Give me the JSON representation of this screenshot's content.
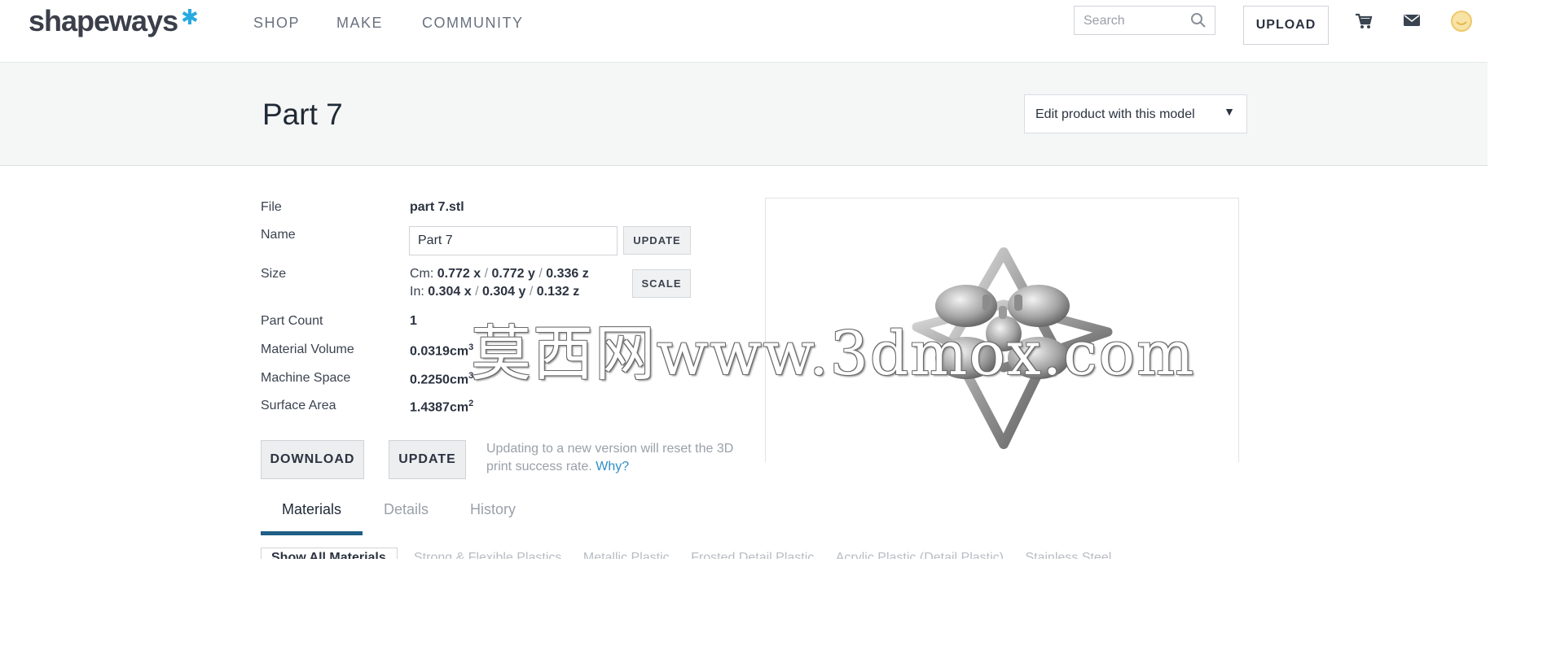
{
  "header": {
    "logo": "shapeways",
    "logo_star_icon": "star-icon",
    "nav": [
      "SHOP",
      "MAKE",
      "COMMUNITY"
    ],
    "search_placeholder": "Search",
    "upload_label": "UPLOAD",
    "icons": [
      "cart-icon",
      "mail-icon",
      "user-avatar-icon"
    ]
  },
  "title_band": {
    "title": "Part 7",
    "edit_dropdown": "Edit product with this model"
  },
  "details": {
    "file": {
      "label": "File",
      "value": "part 7.stl"
    },
    "name": {
      "label": "Name",
      "value": "Part 7",
      "button": "UPDATE"
    },
    "size": {
      "label": "Size",
      "cm_label": "Cm:",
      "cm_x": "0.772 x",
      "cm_y": "0.772 y",
      "cm_z": "0.336 z",
      "in_label": "In:",
      "in_x": "0.304 x",
      "in_y": "0.304 y",
      "in_z": "0.132 z",
      "sep": "/",
      "button": "SCALE"
    },
    "part_count": {
      "label": "Part Count",
      "value": "1"
    },
    "material_volume": {
      "label": "Material Volume",
      "value": "0.0319cm",
      "sup": "3"
    },
    "machine_space": {
      "label": "Machine Space",
      "value": "0.2250cm",
      "sup": "3"
    },
    "surface_area": {
      "label": "Surface Area",
      "value": "1.4387cm",
      "sup": "2"
    }
  },
  "actions": {
    "download": "DOWNLOAD",
    "update": "UPDATE",
    "note": "Updating to a new version will reset the 3D print success rate.",
    "note_link": "Why?"
  },
  "watermark": "莫西网www.3dmox.com",
  "tabs": [
    {
      "label": "Materials",
      "active": true
    },
    {
      "label": "Details",
      "active": false
    },
    {
      "label": "History",
      "active": false
    }
  ],
  "materials_bar": {
    "button": "Show All Materials",
    "items": [
      "Strong & Flexible Plastics",
      "Metallic Plastic",
      "Frosted Detail Plastic",
      "Acrylic Plastic (Detail Plastic)",
      "Stainless Steel"
    ]
  },
  "colors": {
    "accent": "#1f5f86",
    "link": "#2f8fc4",
    "band": "#f5f6f6",
    "logo_star": "#27a9e1"
  }
}
